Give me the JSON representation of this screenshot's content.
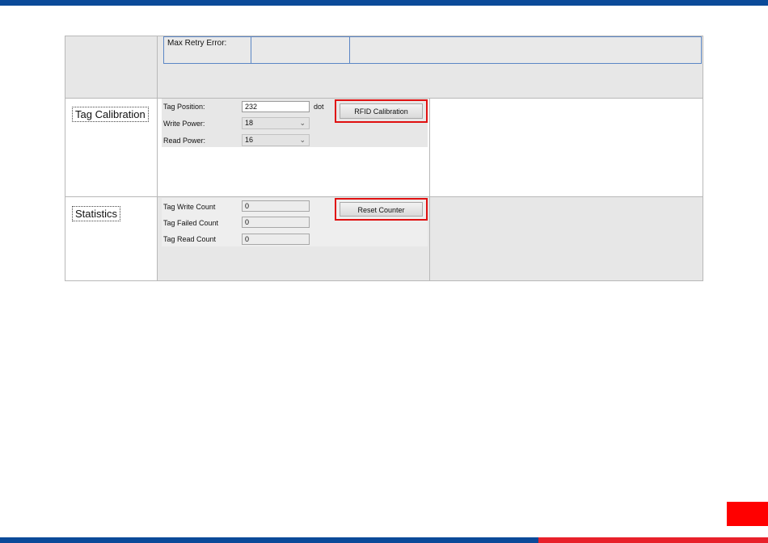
{
  "max_retry": {
    "label": "Max Retry Error:"
  },
  "tag_calibration": {
    "section_label": "Tag Calibration",
    "tag_position_label": "Tag Position:",
    "tag_position_value": "232",
    "tag_position_unit": "dot",
    "write_power_label": "Write Power:",
    "write_power_value": "18",
    "read_power_label": "Read Power:",
    "read_power_value": "16",
    "button_label": "RFID Calibration"
  },
  "statistics": {
    "section_label": "Statistics",
    "write_count_label": "Tag Write Count",
    "write_count_value": "0",
    "failed_count_label": "Tag Failed Count",
    "failed_count_value": "0",
    "read_count_label": "Tag Read Count",
    "read_count_value": "0",
    "button_label": "Reset Counter"
  },
  "colors": {
    "brand_blue": "#0b4a99",
    "brand_red": "#e8202a",
    "highlight_red": "#e01010"
  },
  "icons": {
    "dropdown": "chevron-down-icon"
  }
}
